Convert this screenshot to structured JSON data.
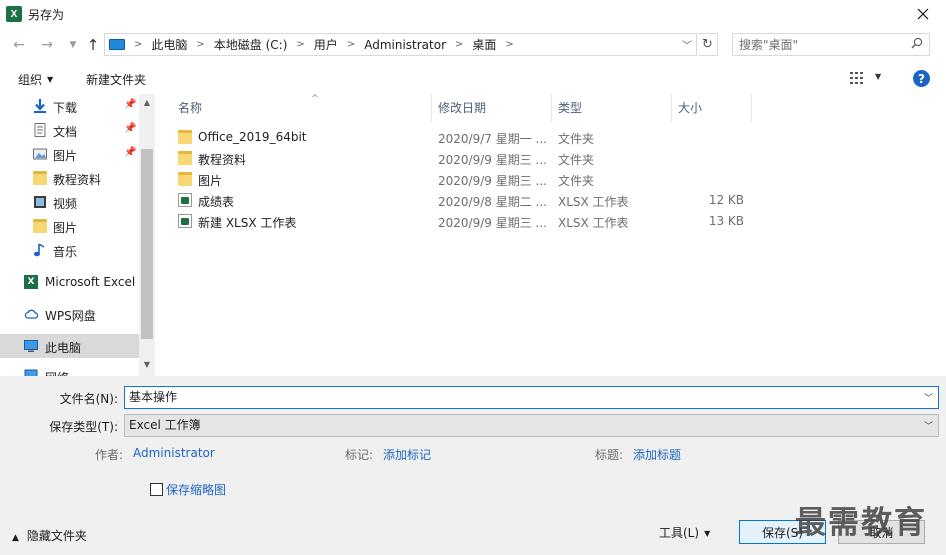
{
  "window": {
    "title": "另存为",
    "app_icon": "excel-icon"
  },
  "navigation": {
    "breadcrumb": [
      "此电脑",
      "本地磁盘 (C:)",
      "用户",
      "Administrator",
      "桌面"
    ],
    "search_placeholder": "搜索\"桌面\""
  },
  "toolbar": {
    "organize": "组织",
    "new_folder": "新建文件夹"
  },
  "sidebar": {
    "items": [
      {
        "label": "下载",
        "icon": "download-icon",
        "pinned": true
      },
      {
        "label": "文档",
        "icon": "document-icon",
        "pinned": true
      },
      {
        "label": "图片",
        "icon": "picture-icon",
        "pinned": true
      },
      {
        "label": "教程资料",
        "icon": "folder-icon",
        "pinned": false
      },
      {
        "label": "视频",
        "icon": "video-icon",
        "pinned": false
      },
      {
        "label": "图片",
        "icon": "folder-icon",
        "pinned": false
      },
      {
        "label": "音乐",
        "icon": "music-icon",
        "pinned": false
      },
      {
        "label": "Microsoft Excel",
        "icon": "excel-icon",
        "pinned": false
      },
      {
        "label": "WPS网盘",
        "icon": "cloud-icon",
        "pinned": false
      },
      {
        "label": "此电脑",
        "icon": "computer-icon",
        "pinned": false,
        "selected": true
      },
      {
        "label": "网络",
        "icon": "network-icon",
        "pinned": false
      }
    ]
  },
  "files": {
    "columns": [
      "名称",
      "修改日期",
      "类型",
      "大小"
    ],
    "rows": [
      {
        "name": "Office_2019_64bit",
        "date": "2020/9/7 星期一 ...",
        "type": "文件夹",
        "size": "",
        "icon": "folder-icon"
      },
      {
        "name": "教程资料",
        "date": "2020/9/9 星期三 ...",
        "type": "文件夹",
        "size": "",
        "icon": "folder-icon"
      },
      {
        "name": "图片",
        "date": "2020/9/9 星期三 ...",
        "type": "文件夹",
        "size": "",
        "icon": "folder-icon"
      },
      {
        "name": "成绩表",
        "date": "2020/9/8 星期二 ...",
        "type": "XLSX 工作表",
        "size": "12 KB",
        "icon": "xlsx-icon"
      },
      {
        "name": "新建 XLSX 工作表",
        "date": "2020/9/9 星期三 ...",
        "type": "XLSX 工作表",
        "size": "13 KB",
        "icon": "xlsx-icon"
      }
    ]
  },
  "form": {
    "filename_label": "文件名(N):",
    "filename_value": "基本操作",
    "filetype_label": "保存类型(T):",
    "filetype_value": "Excel 工作簿",
    "author_label": "作者:",
    "author_value": "Administrator",
    "tags_label": "标记:",
    "tags_value": "添加标记",
    "title_label": "标题:",
    "title_value": "添加标题",
    "thumbnail_label": "保存缩略图"
  },
  "footer": {
    "hide_folders": "隐藏文件夹",
    "tools": "工具(L)",
    "save": "保存(S)",
    "cancel": "取消",
    "watermark": "最需教育"
  },
  "colors": {
    "accent": "#0078d7",
    "link": "#1a64c5",
    "excel_green": "#1d7044",
    "folder": "#f8d775"
  }
}
